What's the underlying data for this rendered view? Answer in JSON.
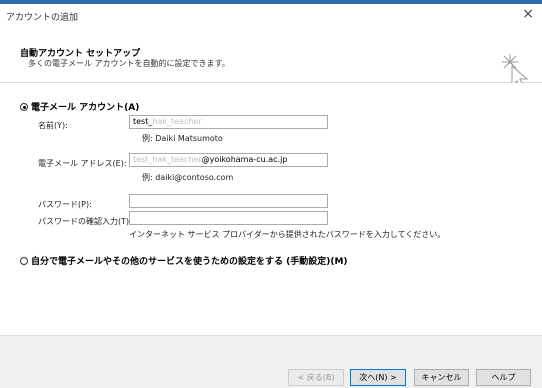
{
  "window": {
    "title": "アカウントの追加",
    "close_glyph": "×"
  },
  "header": {
    "title": "自動アカウント セットアップ",
    "subtitle": "多くの電子メール アカウントを自動的に設定できます。"
  },
  "email_option": {
    "label": "電子メール アカウント(A)",
    "selected": true,
    "name": {
      "label": "名前(Y):",
      "value_prefix": "test_",
      "value_greyed": "hak_teacher",
      "example": "例: Daiki Matsumoto"
    },
    "email": {
      "label": "電子メール アドレス(E):",
      "value_greyed": "test_hak_teacher",
      "value_suffix": "@yoikohama-cu.ac.jp",
      "example": "例: daiki@contoso.com"
    },
    "password": {
      "label": "パスワード(P):",
      "value": ""
    },
    "password_confirm": {
      "label": "パスワードの確認入力(T):",
      "value": ""
    },
    "password_hint": "インターネット サービス プロバイダーから提供されたパスワードを入力してください。"
  },
  "manual_option": {
    "label": "自分で電子メールやその他のサービスを使うための設定をする (手動設定)(M)",
    "selected": false
  },
  "footer": {
    "back_label": "< 戻る(B)",
    "next_label": "次へ(N) >",
    "cancel_label": "キャンセル",
    "help_label": "ヘルプ"
  },
  "colors": {
    "accent": "#0078d7",
    "title_border": "#2b6cb0"
  },
  "icons": {
    "wizard": "wizard-cursor-icon",
    "close": "close-icon"
  }
}
